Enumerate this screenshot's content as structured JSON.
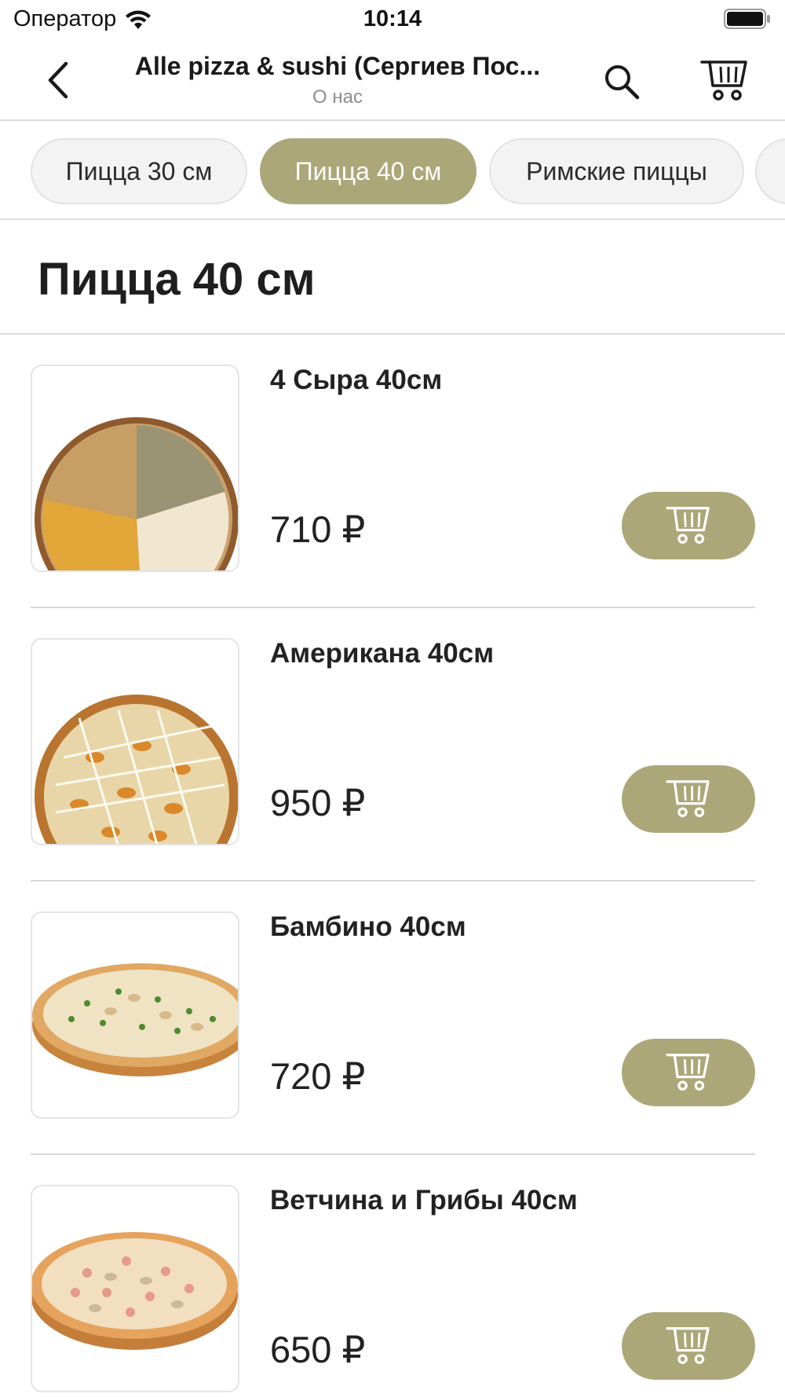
{
  "status_bar": {
    "carrier": "Оператор",
    "time": "10:14"
  },
  "nav": {
    "title": "Alle pizza & sushi (Сергиев Пос...",
    "subtitle": "О нас",
    "back_icon": "chevron-left-icon",
    "search_icon": "search-icon",
    "cart_icon": "cart-icon"
  },
  "categories": [
    {
      "label": "Пицца 30 см",
      "active": false
    },
    {
      "label": "Пицца 40 см",
      "active": true
    },
    {
      "label": "Римские пиццы",
      "active": false
    }
  ],
  "section": {
    "title": "Пицца 40 см"
  },
  "products": [
    {
      "name": "4 Сыра 40см",
      "price": "710 ₽"
    },
    {
      "name": "Американа 40см",
      "price": "950 ₽"
    },
    {
      "name": "Бамбино 40см",
      "price": "720 ₽"
    },
    {
      "name": "Ветчина и Грибы 40см",
      "price": "650 ₽"
    }
  ],
  "colors": {
    "accent": "#aca779",
    "chip_bg": "#f3f3f3",
    "divider": "#dcdcdc"
  }
}
